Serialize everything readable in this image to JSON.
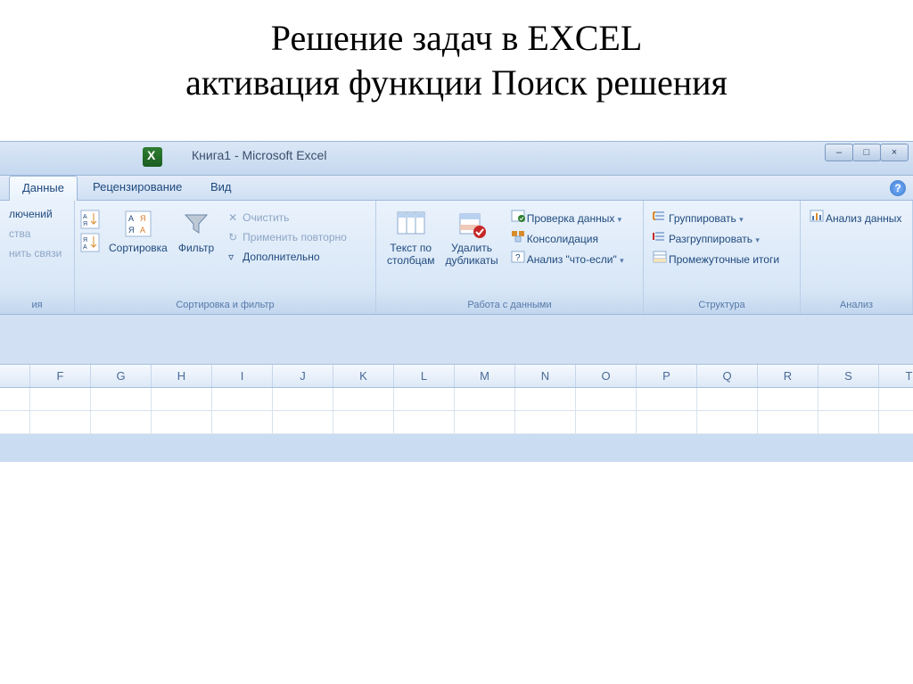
{
  "slide": {
    "title_line1": "Решение задач в EXCEL",
    "title_line2": "активация функции Поиск решения"
  },
  "titlebar": {
    "document": "Книга1 - Microsoft Excel"
  },
  "window_controls": {
    "min": "–",
    "max": "□",
    "close": "×"
  },
  "tabs": {
    "data": "Данные",
    "review": "Рецензирование",
    "view": "Вид"
  },
  "help": "?",
  "ribbon": {
    "connections": {
      "partial_top": "лючений",
      "partial_mid": "ства",
      "partial_bot": "нить связи",
      "group_label": "ия"
    },
    "sort_filter": {
      "sort_asc_hint": "A→Я",
      "sort_desc_hint": "Я→A",
      "sort_label": "Сортировка",
      "filter_label": "Фильтр",
      "clear": "Очистить",
      "reapply": "Применить повторно",
      "advanced": "Дополнительно",
      "group_label": "Сортировка и фильтр"
    },
    "data_tools": {
      "text_to_columns_l1": "Текст по",
      "text_to_columns_l2": "столбцам",
      "remove_dup_l1": "Удалить",
      "remove_dup_l2": "дубликаты",
      "data_validation": "Проверка данных",
      "consolidate": "Консолидация",
      "what_if": "Анализ \"что-если\"",
      "group_label": "Работа с данными"
    },
    "outline": {
      "group": "Группировать",
      "ungroup": "Разгруппировать",
      "subtotal": "Промежуточные итоги",
      "group_label": "Структура"
    },
    "analysis": {
      "data_analysis": "Анализ данных",
      "group_label": "Анализ"
    }
  },
  "columns": [
    "",
    "F",
    "G",
    "H",
    "I",
    "J",
    "K",
    "L",
    "M",
    "N",
    "O",
    "P",
    "Q",
    "R",
    "S",
    "T"
  ]
}
